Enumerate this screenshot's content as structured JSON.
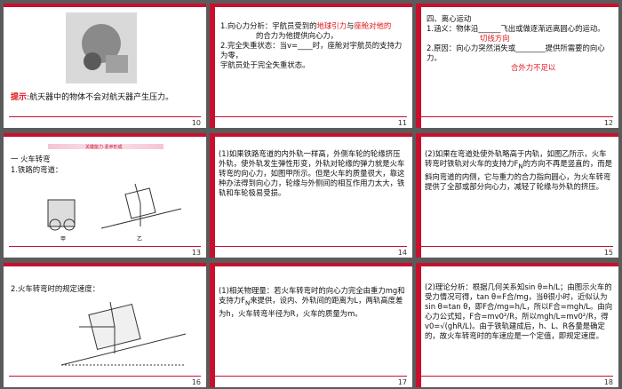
{
  "slides": [
    {
      "num": "10",
      "hint_label": "提示",
      "hint_text": "航天器中的物体不会对航天器产生压力。"
    },
    {
      "num": "11",
      "line1": "1.向心力分析：宇航员受到的",
      "red1": "地球引力",
      "line1b": "与",
      "red2": "座舱对他的",
      "line2": "的合力为他提供向心力，",
      "line3": "2.完全失重状态：当v=",
      "line3b": "时，座舱对宇航员的支持力为零，",
      "line4": "宇航员处于完全失重状态。"
    },
    {
      "num": "12",
      "h": "四、离心运动",
      "l1": "1.涵义：物体沿",
      "red1": "切线方向",
      "l1b": "飞出或做逐渐远离圆心的运动。",
      "l2": "2.原因：向心力突然消失或",
      "l2b": "提供所需要的向心力。",
      "red2": "合外力不足以"
    },
    {
      "num": "13",
      "banner": "关键能力·素养形成",
      "h": "一 火车转弯",
      "l1": "1.铁路的弯道：",
      "fig_a": "甲",
      "fig_b": "乙"
    },
    {
      "num": "14",
      "text": "(1)如果铁路弯道的内外轨一样高，外侧车轮的轮缘挤压外轨，使外轨发生弹性形变，外轨对轮缘的弹力就是火车转弯的向心力，如图甲所示。但是火车的质量很大，靠这种办法得到向心力，轮缘与外侧间的相互作用力太大，铁轨和车轮极易受损。"
    },
    {
      "num": "15",
      "text": "(2)如果在弯道处使外轨略高于内轨，如图乙所示，火车转弯时铁轨对火车的支持力F",
      "text2": "的方向不再是竖直的，而是斜向弯道的内侧，它与重力的合力指向圆心，为火车转弯提供了全部或部分向心力，减轻了轮缘与外轨的挤压。"
    },
    {
      "num": "16",
      "h": "2.火车转弯时的规定速度："
    },
    {
      "num": "17",
      "text": "(1)相关物理量：若火车转弯时的向心力完全由重力mg和支持力F",
      "text2": "来提供，设内、外轨间的距离为L，两轨高度差为h，火车转弯半径为R，火车的质量为m。"
    },
    {
      "num": "18",
      "text": "(2)理论分析：根据几何关系知sin θ=",
      "text2": "；由图示火车的受力情况可得，tan θ=",
      "text3": "，当θ很小时，近似认为sin θ=tan θ，即",
      "text4": "，所以F合=mg",
      "text5": "。由向心力公式知，F合=m",
      "text6": "，所以mg",
      "text7": "=m",
      "text8": "，得v0=",
      "text9": "。由于铁轨建成后，h、L、R各量是确定的，故火车转弯时的车速应是一个定值，即规定速度。"
    }
  ]
}
